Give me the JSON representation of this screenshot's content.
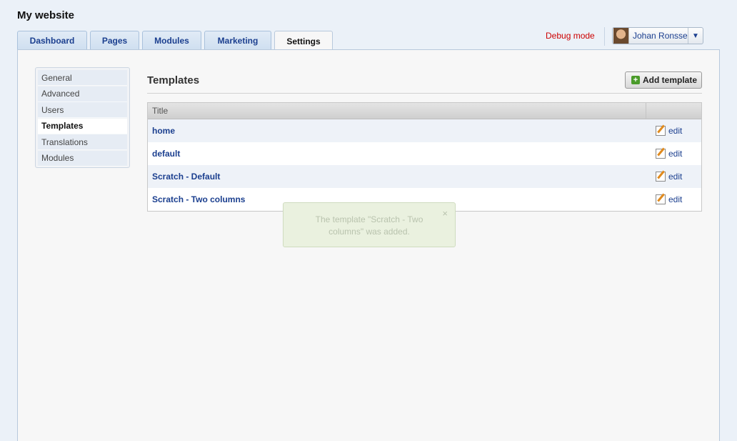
{
  "site": {
    "title": "My website"
  },
  "tabs": [
    {
      "label": "Dashboard"
    },
    {
      "label": "Pages"
    },
    {
      "label": "Modules"
    },
    {
      "label": "Marketing"
    },
    {
      "label": "Settings",
      "active": true
    }
  ],
  "header": {
    "debug_label": "Debug mode",
    "user_name": "Johan Ronsse",
    "user_caret": "▼"
  },
  "subnav": {
    "items": [
      {
        "label": "General"
      },
      {
        "label": "Advanced"
      },
      {
        "label": "Users"
      },
      {
        "label": "Templates",
        "active": true
      },
      {
        "label": "Translations"
      },
      {
        "label": "Modules"
      }
    ]
  },
  "content": {
    "title": "Templates",
    "add_button_label": "Add template",
    "add_icon": "+",
    "table": {
      "columns": [
        "Title",
        ""
      ],
      "rows": [
        {
          "title": "home",
          "action": "edit"
        },
        {
          "title": "default",
          "action": "edit"
        },
        {
          "title": "Scratch - Default",
          "action": "edit"
        },
        {
          "title": "Scratch - Two columns",
          "action": "edit"
        }
      ]
    }
  },
  "toast": {
    "message": "The template \"Scratch - Two columns\" was added.",
    "close": "×"
  },
  "colors": {
    "accent": "#1b3f8f",
    "debug": "#cc0000",
    "toast_bg": "#eaf1df"
  }
}
